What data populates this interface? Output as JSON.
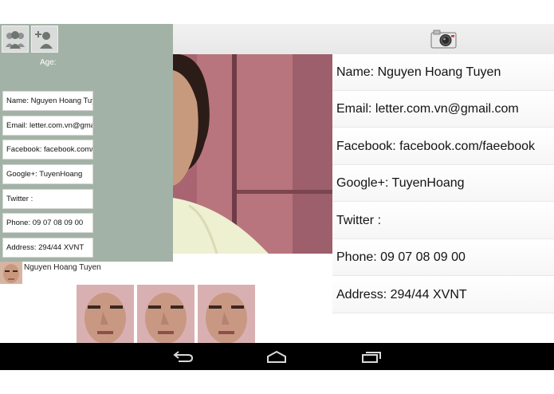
{
  "profile_form": {
    "age_label": "Age:",
    "fields": [
      "Name: Nguyen Hoang Tuyen",
      "Email: letter.com.vn@gmail.com",
      "Facebook: facebook.com/faeebook",
      "Google+: TuyenHoang",
      "Twitter :",
      "Phone: 09 07 08 09 00",
      "Address: 294/44 XVNT"
    ]
  },
  "contact": {
    "name": "Nguyen Hoang Tuyen"
  },
  "details": {
    "rows": [
      "Name: Nguyen Hoang Tuyen",
      "Email: letter.com.vn@gmail.com",
      "Facebook: facebook.com/faeebook",
      "Google+: TuyenHoang",
      "Twitter :",
      "Phone: 09 07 08 09 00",
      "Address: 294/44 XVNT"
    ]
  },
  "icons": {
    "header": [
      "contacts-group-icon",
      "add-contact-icon",
      "camera-icon"
    ],
    "navigation": [
      "back-icon",
      "home-icon",
      "recent-apps-icon"
    ]
  },
  "colors": {
    "panel": "#a3b2a6",
    "navbar": "#000000"
  }
}
